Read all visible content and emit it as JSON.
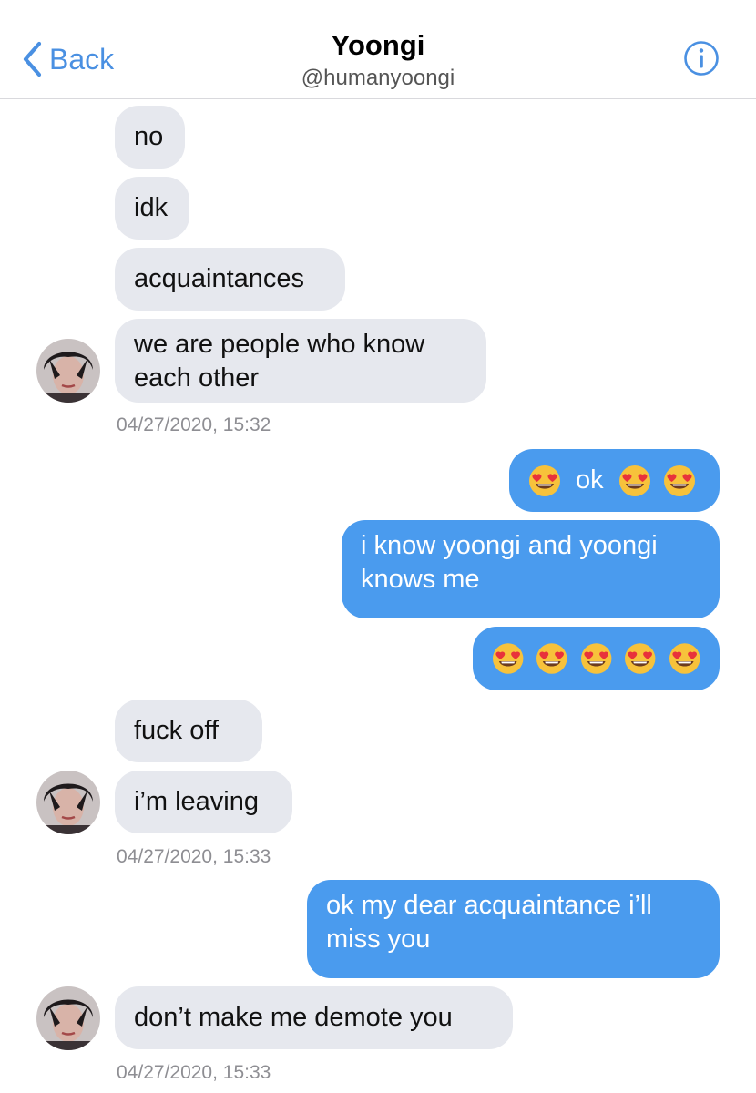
{
  "header": {
    "back_label": "Back",
    "title": "Yoongi",
    "handle": "@humanyoongi",
    "back_icon": "chevron-left-icon",
    "info_icon": "info-icon",
    "accent_color": "#4a90e2"
  },
  "colors": {
    "incoming_bubble": "#e6e8ee",
    "outgoing_bubble": "#4a9bee",
    "timestamp": "#8e8e93"
  },
  "messages": [
    {
      "text": "no"
    },
    {
      "text": "idk"
    },
    {
      "text": "acquaintances"
    },
    {
      "line1": "we are people who know",
      "line2": "each other"
    },
    {
      "timestamp": "04/27/2020, 15:32"
    },
    {
      "text": "ok",
      "emoji": "heart-eyes-emoji"
    },
    {
      "line1": "i know yoongi and yoongi",
      "line2": "knows me"
    },
    {
      "emoji_count": 5
    },
    {
      "text": "fuck off"
    },
    {
      "text": "i’m leaving"
    },
    {
      "timestamp": "04/27/2020, 15:33"
    },
    {
      "line1": "ok my dear acquaintance i’ll",
      "line2": "miss you"
    },
    {
      "text": "don’t make me demote you"
    },
    {
      "timestamp": "04/27/2020, 15:33"
    }
  ]
}
